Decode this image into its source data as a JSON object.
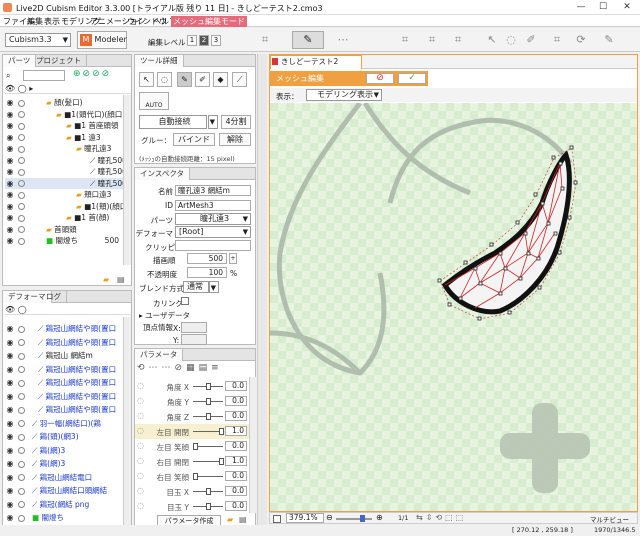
{
  "window": {
    "title": "Live2D Cubism Editor 3.3.00 [トライアル版 残り 11 日] - きしどーテスト2.cmo3",
    "min": "—",
    "max": "☐",
    "close": "✕"
  },
  "menu": [
    "ファイル",
    "編集",
    "表示",
    "モデリング",
    "アニメーション",
    "ウインドウ",
    "ヘルプ",
    "メッシュ編集モード"
  ],
  "toolbar": {
    "workspace": "Cubism3.3",
    "mode_icon": "M",
    "mode": "Modeler",
    "edit_level_label": "編集レベル：",
    "levels": [
      "1",
      "2",
      "3"
    ]
  },
  "parts_panel": {
    "tabs": [
      "パーツ",
      "プロジェクト"
    ],
    "items": [
      {
        "indent": 18,
        "type": "folder",
        "label": "顔(髪口)"
      },
      {
        "indent": 28,
        "type": "folder",
        "label": "■1(頭代口)(顔口)"
      },
      {
        "indent": 38,
        "type": "folder",
        "label": "■1 首座頭領"
      },
      {
        "indent": 38,
        "type": "folder",
        "label": "■1 遠3"
      },
      {
        "indent": 48,
        "type": "folder",
        "label": "瞳孔遠3"
      },
      {
        "indent": 62,
        "type": "mesh",
        "label": "瞳孔500",
        "num": ""
      },
      {
        "indent": 62,
        "type": "mesh",
        "label": "瞳孔500",
        "num": ""
      },
      {
        "indent": 62,
        "type": "mesh",
        "label": "瞳孔500",
        "num": ""
      },
      {
        "indent": 48,
        "type": "folder",
        "label": "頬口遠3"
      },
      {
        "indent": 48,
        "type": "folder",
        "label": "■1(頬)(顔口)"
      },
      {
        "indent": 38,
        "type": "folder",
        "label": "■1 首(顔)"
      },
      {
        "indent": 18,
        "type": "folder",
        "label": "首頭頭"
      },
      {
        "indent": 18,
        "type": "green",
        "label": "闇燈ち",
        "num": "500"
      }
    ]
  },
  "deformer_panel": {
    "tabs": [
      "デフォーマ",
      "ログ"
    ],
    "items": [
      {
        "indent": 10,
        "label": "鶏冠山網結や頭(置口"
      },
      {
        "indent": 10,
        "label": "鶏冠山網結や頭(置口"
      },
      {
        "indent": 10,
        "label": "鶏冠山 網結m"
      },
      {
        "indent": 10,
        "label": "鶏冠山網結や頭(置口"
      },
      {
        "indent": 10,
        "label": "鶏冠山網結や頭(置口"
      },
      {
        "indent": 10,
        "label": "鶏冠山網結や頭(置口"
      },
      {
        "indent": 10,
        "label": "鶏冠山網結や頭(置口"
      },
      {
        "indent": 4,
        "label": "羽一幅(網結口)(鶏"
      },
      {
        "indent": 4,
        "label": "鶏(頭)(網3)"
      },
      {
        "indent": 4,
        "label": "鶏(網)3"
      },
      {
        "indent": 4,
        "label": "鶏(網)3"
      },
      {
        "indent": 4,
        "label": "鶏冠山網結電口"
      },
      {
        "indent": 4,
        "label": "鶏冠山網結口頭網結"
      },
      {
        "indent": 4,
        "label": "鶏冠(網結 png"
      },
      {
        "indent": 4,
        "label": "闇燈ち"
      }
    ]
  },
  "tool_panel": {
    "title": "ツール詳細",
    "auto": "AUTO",
    "auto_connect": "自動接続",
    "split": "4分割",
    "glue_label": "グルー：",
    "bind": "バインド",
    "unbind": "解除",
    "note": "(ﾒｯｼｭの自動接続距離：15 pixel)"
  },
  "inspector": {
    "title": "インスペクタ",
    "name_label": "名前",
    "name": "瞳孔遠3 網結m",
    "id_label": "ID",
    "id": "ArtMesh3",
    "part_label": "パーツ",
    "part": "瞳孔遠3",
    "deformer_label": "デフォーマ",
    "deformer": "[Root]",
    "clip_label": "クリッピング",
    "clip": "",
    "order_label": "描画順",
    "order": "500",
    "opacity_label": "不透明度",
    "opacity": "100",
    "pct": "%",
    "blend_label": "ブレンド方式",
    "blend": "通常",
    "culling_label": "カリング",
    "userdata_label": "▸ ユーザデータ",
    "vertex_label": "頂点情報",
    "vx": "X:",
    "vy": "Y:"
  },
  "params_panel": {
    "title": "パラメータ",
    "footer_button": "パラメータ作成",
    "items": [
      {
        "label": "角度 X",
        "val": "0.0",
        "pos": 0.5
      },
      {
        "label": "角度 Y",
        "val": "0.0",
        "pos": 0.5
      },
      {
        "label": "角度 Z",
        "val": "0.0",
        "pos": 0.5
      },
      {
        "label": "左目 開閉",
        "val": "1.0",
        "pos": 1.0,
        "hl": true
      },
      {
        "label": "左目 笑顔",
        "val": "0.0",
        "pos": 0.0
      },
      {
        "label": "右目 開閉",
        "val": "1.0",
        "pos": 1.0
      },
      {
        "label": "右目 笑顔",
        "val": "0.0",
        "pos": 0.0
      },
      {
        "label": "目玉 X",
        "val": "0.0",
        "pos": 0.5
      },
      {
        "label": "目玉 Y",
        "val": "0.0",
        "pos": 0.5
      }
    ]
  },
  "canvas": {
    "doc_tab": "きしどーテスト2",
    "mesh_edit": "メッシュ編集",
    "view_label": "表示：",
    "view_mode": "モデリング表示"
  },
  "statusbar": {
    "zoom": "379.1%",
    "page": "1/1",
    "multiview": "マルチビュー",
    "coords": "[ 270.12 , 259.18 ]",
    "size": "1970/1346.5"
  },
  "colors": {
    "accent": "#f0a040",
    "menu_active": "#e56a7a",
    "mesh_edge": "#cc2222",
    "canvas_bg": "#e2f2dc"
  }
}
